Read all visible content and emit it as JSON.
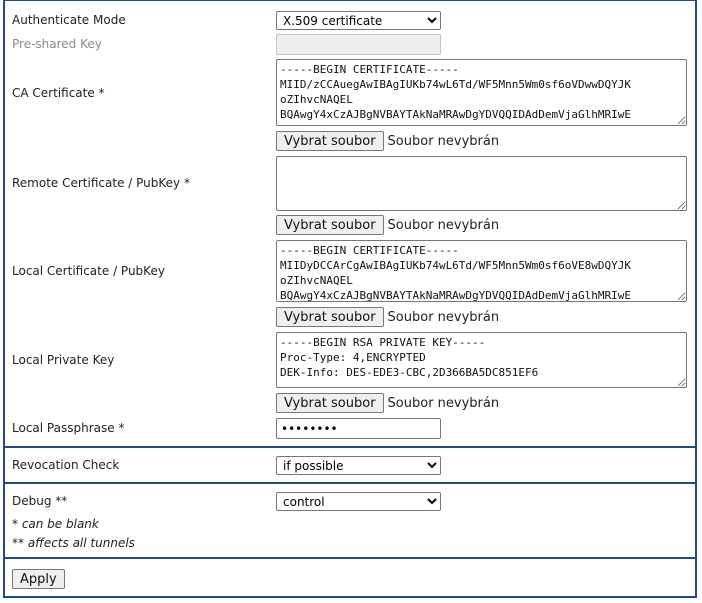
{
  "fields": {
    "auth_mode": {
      "label": "Authenticate Mode",
      "value": "X.509 certificate",
      "options": [
        "X.509 certificate"
      ]
    },
    "psk": {
      "label": "Pre-shared Key",
      "value": ""
    },
    "ca_cert": {
      "label": "CA Certificate *",
      "value": "-----BEGIN CERTIFICATE-----\nMIID/zCCAuegAwIBAgIUKb74wL6Td/WF5Mnn5Wm0sf6oVDwwDQYJK\noZIhvcNAQEL\nBQAwgY4xCzAJBgNVBAYTAkNaMRAwDgYDVQQIDAdDemVjaGlhMRIwE"
    },
    "remote_cert": {
      "label": "Remote Certificate / PubKey *",
      "value": ""
    },
    "local_cert": {
      "label": "Local Certificate / PubKey",
      "value": "-----BEGIN CERTIFICATE-----\nMIIDyDCCArCgAwIBAgIUKb74wL6Td/WF5Mnn5Wm0sf6oVE8wDQYJK\noZIhvcNAQEL\nBQAwgY4xCzAJBgNVBAYTAkNaMRAwDgYDVQQIDAdDemVjaGlhMRIwE"
    },
    "local_key": {
      "label": "Local Private Key",
      "value": "-----BEGIN RSA PRIVATE KEY-----\nProc-Type: 4,ENCRYPTED\nDEK-Info: DES-EDE3-CBC,2D366BA5DC851EF6"
    },
    "passphrase": {
      "label": "Local Passphrase *",
      "value": "••••••••"
    },
    "revocation": {
      "label": "Revocation Check",
      "value": "if possible",
      "options": [
        "if possible"
      ]
    },
    "debug": {
      "label": "Debug **",
      "value": "control",
      "options": [
        "control"
      ]
    }
  },
  "file_picker": {
    "button_label": "Vybrat soubor",
    "status": "Soubor nevybrán"
  },
  "notes": {
    "blank": "* can be blank",
    "tunnels": "** affects all tunnels"
  },
  "apply_label": "Apply",
  "colors": {
    "border": "#1f4a8a",
    "disabled_text": "#8a8a8a"
  }
}
